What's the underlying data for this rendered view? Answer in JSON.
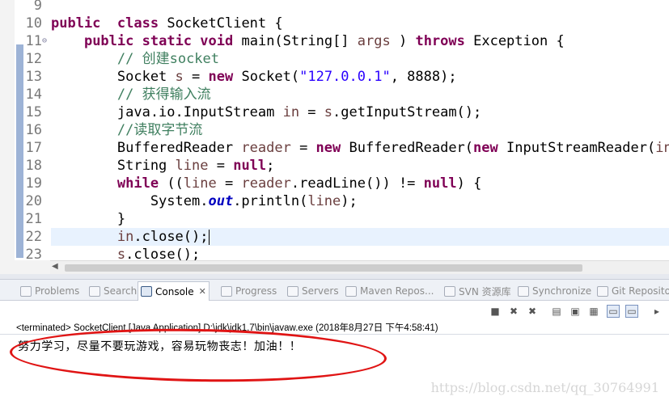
{
  "editor": {
    "lines": [
      {
        "num": "9",
        "code": []
      },
      {
        "num": "10",
        "code": [
          [
            "kw",
            "public"
          ],
          [
            "",
            "  "
          ],
          [
            "kw",
            "class"
          ],
          [
            "",
            " SocketClient {"
          ]
        ]
      },
      {
        "num": "11",
        "fold": "⊖",
        "code": [
          [
            "",
            "    "
          ],
          [
            "kw",
            "public"
          ],
          [
            "",
            " "
          ],
          [
            "kw",
            "static"
          ],
          [
            "",
            " "
          ],
          [
            "kw",
            "void"
          ],
          [
            "",
            " main(String[] "
          ],
          [
            "var",
            "args"
          ],
          [
            "",
            " ) "
          ],
          [
            "kw",
            "throws"
          ],
          [
            "",
            " Exception {"
          ]
        ]
      },
      {
        "num": "12",
        "code": [
          [
            "",
            "        "
          ],
          [
            "cm",
            "// 创建socket"
          ]
        ]
      },
      {
        "num": "13",
        "code": [
          [
            "",
            "        Socket "
          ],
          [
            "var",
            "s"
          ],
          [
            "",
            " = "
          ],
          [
            "kw",
            "new"
          ],
          [
            "",
            " Socket("
          ],
          [
            "str",
            "\"127.0.0.1\""
          ],
          [
            "",
            ", 8888);"
          ]
        ]
      },
      {
        "num": "14",
        "code": [
          [
            "",
            "        "
          ],
          [
            "cm",
            "// 获得输入流"
          ]
        ]
      },
      {
        "num": "15",
        "code": [
          [
            "",
            "        java.io.InputStream "
          ],
          [
            "var",
            "in"
          ],
          [
            "",
            " = "
          ],
          [
            "var",
            "s"
          ],
          [
            "",
            ".getInputStream();"
          ]
        ]
      },
      {
        "num": "16",
        "code": [
          [
            "",
            "        "
          ],
          [
            "cm",
            "//读取字节流"
          ]
        ]
      },
      {
        "num": "17",
        "code": [
          [
            "",
            "        BufferedReader "
          ],
          [
            "var",
            "reader"
          ],
          [
            "",
            " = "
          ],
          [
            "kw",
            "new"
          ],
          [
            "",
            " BufferedReader("
          ],
          [
            "kw",
            "new"
          ],
          [
            "",
            " InputStreamReader("
          ],
          [
            "var",
            "in"
          ],
          [
            "",
            "))"
          ]
        ]
      },
      {
        "num": "18",
        "code": [
          [
            "",
            "        String "
          ],
          [
            "var",
            "line"
          ],
          [
            "",
            " = "
          ],
          [
            "kw",
            "null"
          ],
          [
            "",
            ";"
          ]
        ]
      },
      {
        "num": "19",
        "code": [
          [
            "",
            "        "
          ],
          [
            "kw",
            "while"
          ],
          [
            "",
            " (("
          ],
          [
            "var",
            "line"
          ],
          [
            "",
            " = "
          ],
          [
            "var",
            "reader"
          ],
          [
            "",
            ".readLine()) != "
          ],
          [
            "kw",
            "null"
          ],
          [
            "",
            ") {"
          ]
        ]
      },
      {
        "num": "20",
        "code": [
          [
            "",
            "            System."
          ],
          [
            "fld",
            "out"
          ],
          [
            "",
            ".println("
          ],
          [
            "var",
            "line"
          ],
          [
            "",
            ");"
          ]
        ]
      },
      {
        "num": "21",
        "code": [
          [
            "",
            "        }"
          ]
        ]
      },
      {
        "num": "22",
        "current": true,
        "code": [
          [
            "",
            "        "
          ],
          [
            "var",
            "in"
          ],
          [
            "",
            ".close();"
          ]
        ]
      },
      {
        "num": "23",
        "code": [
          [
            "",
            "        "
          ],
          [
            "var",
            "s"
          ],
          [
            "",
            ".close();"
          ]
        ]
      }
    ]
  },
  "tabs": [
    {
      "label": "Problems",
      "icon": "problems-icon"
    },
    {
      "label": "Search",
      "icon": "search-icon"
    },
    {
      "label": "Console",
      "icon": "console-icon",
      "active": true
    },
    {
      "label": "Progress",
      "icon": "progress-icon"
    },
    {
      "label": "Servers",
      "icon": "servers-icon"
    },
    {
      "label": "Maven Repos...",
      "icon": "maven-icon"
    },
    {
      "label": "SVN 资源库",
      "icon": "svn-icon"
    },
    {
      "label": "Synchronize",
      "icon": "synchronize-icon"
    },
    {
      "label": "Git Reposito",
      "icon": "git-icon"
    }
  ],
  "console": {
    "terminated": "<terminated> SocketClient [Java Application] D:\\jdk\\jdk1.7\\bin\\javaw.exe (2018年8月27日 下午4:58:41)",
    "output": "努力学习，尽量不要玩游戏，容易玩物丧志！加油！！"
  },
  "watermark": "https://blog.csdn.net/qq_30764991",
  "colors": {
    "keyword": "#7f0055",
    "comment": "#3f7f5f",
    "string": "#2a00ff",
    "variable": "#6a3e3e",
    "annotation": "#e01414"
  }
}
